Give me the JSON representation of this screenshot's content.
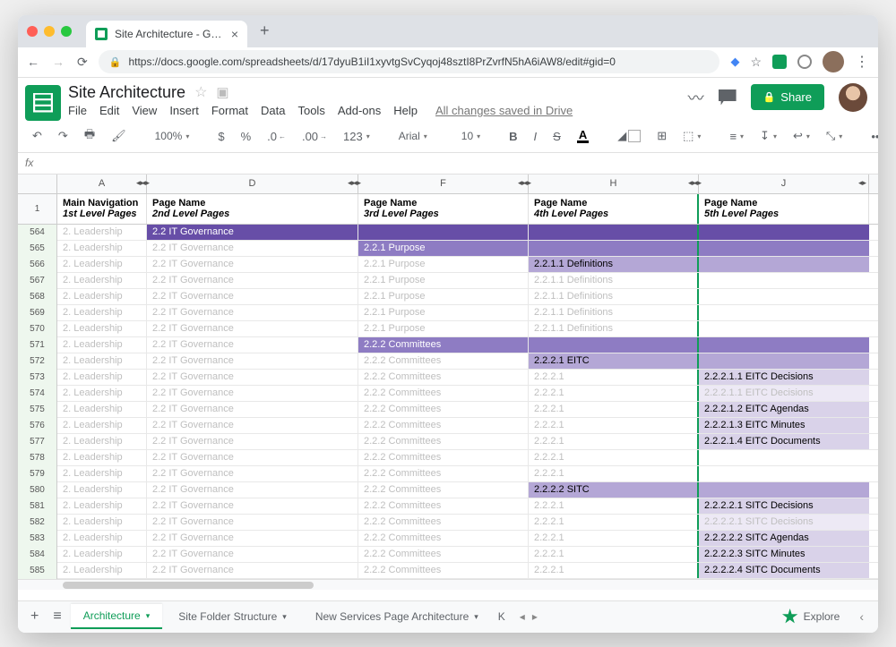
{
  "browser": {
    "tab_title": "Site Architecture - Google She",
    "url": "https://docs.google.com/spreadsheets/d/17dyuB1iI1xyvtgSvCyqoj48sztI8PrZvrfN5hA6iAW8/edit#gid=0"
  },
  "doc": {
    "title": "Site Architecture",
    "menus": [
      "File",
      "Edit",
      "View",
      "Insert",
      "Format",
      "Data",
      "Tools",
      "Add-ons",
      "Help"
    ],
    "save_status": "All changes saved in Drive",
    "share_label": "Share"
  },
  "toolbar": {
    "zoom": "100%",
    "currency": "$",
    "percent": "%",
    "dec_dec": ".0",
    "dec_inc": ".00",
    "numfmt": "123",
    "font": "Arial",
    "fontsize": "10",
    "more": "•••"
  },
  "fx": {
    "label": "fx"
  },
  "columns": [
    {
      "letter": "A",
      "w": "A"
    },
    {
      "letter": "D",
      "w": "D"
    },
    {
      "letter": "F",
      "w": "F"
    },
    {
      "letter": "H",
      "w": "H"
    },
    {
      "letter": "J",
      "w": "J"
    }
  ],
  "headers": {
    "A": {
      "l1": "Main Navigation",
      "l2": "1st Level Pages"
    },
    "D": {
      "l1": "Page Name",
      "l2": "2nd Level Pages"
    },
    "F": {
      "l1": "Page Name",
      "l2": "3rd Level Pages"
    },
    "H": {
      "l1": "Page Name",
      "l2": "4th Level Pages"
    },
    "J": {
      "l1": "Page Name",
      "l2": "5th Level Pages"
    }
  },
  "header_rownum": "1",
  "rows": [
    {
      "n": "564",
      "A": {
        "t": "2. Leadership",
        "c": "ghost"
      },
      "D": {
        "t": "2.2 IT Governance",
        "c": "hl-dark"
      },
      "F": {
        "t": "",
        "c": "hl-dark"
      },
      "H": {
        "t": "",
        "c": "hl-dark"
      },
      "J": {
        "t": "",
        "c": "hl-dark"
      }
    },
    {
      "n": "565",
      "A": {
        "t": "2. Leadership",
        "c": "ghost"
      },
      "D": {
        "t": "2.2 IT Governance",
        "c": "ghost"
      },
      "F": {
        "t": "2.2.1 Purpose",
        "c": "hl-med"
      },
      "H": {
        "t": "",
        "c": "hl-med"
      },
      "J": {
        "t": "",
        "c": "hl-med"
      }
    },
    {
      "n": "566",
      "A": {
        "t": "2. Leadership",
        "c": "ghost"
      },
      "D": {
        "t": "2.2 IT Governance",
        "c": "ghost"
      },
      "F": {
        "t": "2.2.1 Purpose",
        "c": "ghost"
      },
      "H": {
        "t": "2.2.1.1 Definitions",
        "c": "hl-lt1"
      },
      "J": {
        "t": "",
        "c": "hl-lt1"
      }
    },
    {
      "n": "567",
      "A": {
        "t": "2. Leadership",
        "c": "ghost"
      },
      "D": {
        "t": "2.2 IT Governance",
        "c": "ghost"
      },
      "F": {
        "t": "2.2.1 Purpose",
        "c": "ghost"
      },
      "H": {
        "t": "2.2.1.1 Definitions",
        "c": "ghost"
      },
      "J": {
        "t": "",
        "c": ""
      }
    },
    {
      "n": "568",
      "A": {
        "t": "2. Leadership",
        "c": "ghost"
      },
      "D": {
        "t": "2.2 IT Governance",
        "c": "ghost"
      },
      "F": {
        "t": "2.2.1 Purpose",
        "c": "ghost"
      },
      "H": {
        "t": "2.2.1.1 Definitions",
        "c": "ghost"
      },
      "J": {
        "t": "",
        "c": ""
      }
    },
    {
      "n": "569",
      "A": {
        "t": "2. Leadership",
        "c": "ghost"
      },
      "D": {
        "t": "2.2 IT Governance",
        "c": "ghost"
      },
      "F": {
        "t": "2.2.1 Purpose",
        "c": "ghost"
      },
      "H": {
        "t": "2.2.1.1 Definitions",
        "c": "ghost"
      },
      "J": {
        "t": "",
        "c": ""
      }
    },
    {
      "n": "570",
      "A": {
        "t": "2. Leadership",
        "c": "ghost"
      },
      "D": {
        "t": "2.2 IT Governance",
        "c": "ghost"
      },
      "F": {
        "t": "2.2.1 Purpose",
        "c": "ghost"
      },
      "H": {
        "t": "2.2.1.1 Definitions",
        "c": "ghost"
      },
      "J": {
        "t": "",
        "c": ""
      }
    },
    {
      "n": "571",
      "A": {
        "t": "2. Leadership",
        "c": "ghost"
      },
      "D": {
        "t": "2.2 IT Governance",
        "c": "ghost"
      },
      "F": {
        "t": "2.2.2 Committees",
        "c": "hl-med"
      },
      "H": {
        "t": "",
        "c": "hl-med"
      },
      "J": {
        "t": "",
        "c": "hl-med"
      }
    },
    {
      "n": "572",
      "A": {
        "t": "2. Leadership",
        "c": "ghost"
      },
      "D": {
        "t": "2.2 IT Governance",
        "c": "ghost"
      },
      "F": {
        "t": "2.2.2 Committees",
        "c": "ghost"
      },
      "H": {
        "t": "2.2.2.1 EITC",
        "c": "hl-lt1"
      },
      "J": {
        "t": "",
        "c": "hl-lt1"
      }
    },
    {
      "n": "573",
      "A": {
        "t": "2. Leadership",
        "c": "ghost"
      },
      "D": {
        "t": "2.2 IT Governance",
        "c": "ghost"
      },
      "F": {
        "t": "2.2.2 Committees",
        "c": "ghost"
      },
      "H": {
        "t": "2.2.2.1",
        "c": "ghost"
      },
      "J": {
        "t": "2.2.2.1.1 EITC Decisions",
        "c": "hl-lt2"
      }
    },
    {
      "n": "574",
      "A": {
        "t": "2. Leadership",
        "c": "ghost"
      },
      "D": {
        "t": "2.2 IT Governance",
        "c": "ghost"
      },
      "F": {
        "t": "2.2.2 Committees",
        "c": "ghost"
      },
      "H": {
        "t": "2.2.2.1",
        "c": "ghost"
      },
      "J": {
        "t": "2.2.2.1.1 EITC Decisions",
        "c": "hl-lt3"
      }
    },
    {
      "n": "575",
      "A": {
        "t": "2. Leadership",
        "c": "ghost"
      },
      "D": {
        "t": "2.2 IT Governance",
        "c": "ghost"
      },
      "F": {
        "t": "2.2.2 Committees",
        "c": "ghost"
      },
      "H": {
        "t": "2.2.2.1",
        "c": "ghost"
      },
      "J": {
        "t": "2.2.2.1.2 EITC Agendas",
        "c": "hl-lt2"
      }
    },
    {
      "n": "576",
      "A": {
        "t": "2. Leadership",
        "c": "ghost"
      },
      "D": {
        "t": "2.2 IT Governance",
        "c": "ghost"
      },
      "F": {
        "t": "2.2.2 Committees",
        "c": "ghost"
      },
      "H": {
        "t": "2.2.2.1",
        "c": "ghost"
      },
      "J": {
        "t": "2.2.2.1.3 EITC Minutes",
        "c": "hl-lt2"
      }
    },
    {
      "n": "577",
      "A": {
        "t": "2. Leadership",
        "c": "ghost"
      },
      "D": {
        "t": "2.2 IT Governance",
        "c": "ghost"
      },
      "F": {
        "t": "2.2.2 Committees",
        "c": "ghost"
      },
      "H": {
        "t": "2.2.2.1",
        "c": "ghost"
      },
      "J": {
        "t": "2.2.2.1.4 EITC Documents",
        "c": "hl-lt2"
      }
    },
    {
      "n": "578",
      "A": {
        "t": "2. Leadership",
        "c": "ghost"
      },
      "D": {
        "t": "2.2 IT Governance",
        "c": "ghost"
      },
      "F": {
        "t": "2.2.2 Committees",
        "c": "ghost"
      },
      "H": {
        "t": "2.2.2.1",
        "c": "ghost"
      },
      "J": {
        "t": "",
        "c": ""
      }
    },
    {
      "n": "579",
      "A": {
        "t": "2. Leadership",
        "c": "ghost"
      },
      "D": {
        "t": "2.2 IT Governance",
        "c": "ghost"
      },
      "F": {
        "t": "2.2.2 Committees",
        "c": "ghost"
      },
      "H": {
        "t": "2.2.2.1",
        "c": "ghost"
      },
      "J": {
        "t": "",
        "c": ""
      }
    },
    {
      "n": "580",
      "A": {
        "t": "2. Leadership",
        "c": "ghost"
      },
      "D": {
        "t": "2.2 IT Governance",
        "c": "ghost"
      },
      "F": {
        "t": "2.2.2 Committees",
        "c": "ghost"
      },
      "H": {
        "t": "2.2.2.2 SITC",
        "c": "hl-lt1"
      },
      "J": {
        "t": "",
        "c": "hl-lt1"
      }
    },
    {
      "n": "581",
      "A": {
        "t": "2. Leadership",
        "c": "ghost"
      },
      "D": {
        "t": "2.2 IT Governance",
        "c": "ghost"
      },
      "F": {
        "t": "2.2.2 Committees",
        "c": "ghost"
      },
      "H": {
        "t": "2.2.2.1",
        "c": "ghost"
      },
      "J": {
        "t": "2.2.2.2.1 SITC Decisions",
        "c": "hl-lt2"
      }
    },
    {
      "n": "582",
      "A": {
        "t": "2. Leadership",
        "c": "ghost"
      },
      "D": {
        "t": "2.2 IT Governance",
        "c": "ghost"
      },
      "F": {
        "t": "2.2.2 Committees",
        "c": "ghost"
      },
      "H": {
        "t": "2.2.2.1",
        "c": "ghost"
      },
      "J": {
        "t": "2.2.2.2.1 SITC Decisions",
        "c": "hl-lt3"
      }
    },
    {
      "n": "583",
      "A": {
        "t": "2. Leadership",
        "c": "ghost"
      },
      "D": {
        "t": "2.2 IT Governance",
        "c": "ghost"
      },
      "F": {
        "t": "2.2.2 Committees",
        "c": "ghost"
      },
      "H": {
        "t": "2.2.2.1",
        "c": "ghost"
      },
      "J": {
        "t": "2.2.2.2.2 SITC Agendas",
        "c": "hl-lt2"
      }
    },
    {
      "n": "584",
      "A": {
        "t": "2. Leadership",
        "c": "ghost"
      },
      "D": {
        "t": "2.2 IT Governance",
        "c": "ghost"
      },
      "F": {
        "t": "2.2.2 Committees",
        "c": "ghost"
      },
      "H": {
        "t": "2.2.2.1",
        "c": "ghost"
      },
      "J": {
        "t": "2.2.2.2.3 SITC Minutes",
        "c": "hl-lt2"
      }
    },
    {
      "n": "585",
      "A": {
        "t": "2. Leadership",
        "c": "ghost"
      },
      "D": {
        "t": "2.2 IT Governance",
        "c": "ghost"
      },
      "F": {
        "t": "2.2.2 Committees",
        "c": "ghost"
      },
      "H": {
        "t": "2.2.2.1",
        "c": "ghost"
      },
      "J": {
        "t": "2.2.2.2.4 SITC Documents",
        "c": "hl-lt2"
      }
    }
  ],
  "sheets": {
    "tabs": [
      "Architecture",
      "Site Folder Structure",
      "New Services Page Architecture"
    ],
    "overflow_hint": "K",
    "active": 0,
    "explore": "Explore"
  }
}
